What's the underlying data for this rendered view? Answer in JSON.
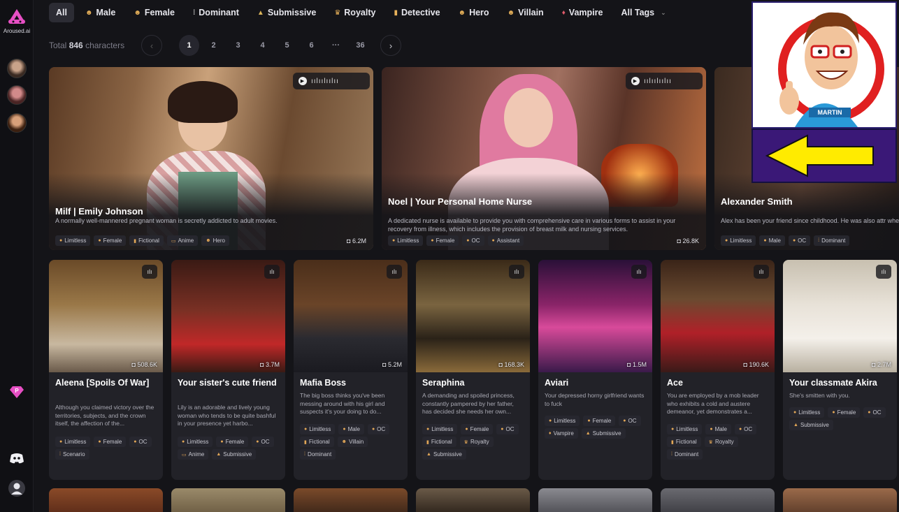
{
  "app": {
    "logo_text": "Aroused.ai"
  },
  "tags": [
    {
      "label": "All",
      "icon": "",
      "active": true
    },
    {
      "label": "Male",
      "icon": "☻"
    },
    {
      "label": "Female",
      "icon": "☻"
    },
    {
      "label": "Dominant",
      "icon": "⁞"
    },
    {
      "label": "Submissive",
      "icon": "▲"
    },
    {
      "label": "Royalty",
      "icon": "♛"
    },
    {
      "label": "Detective",
      "icon": "▮"
    },
    {
      "label": "Hero",
      "icon": "☻"
    },
    {
      "label": "Villain",
      "icon": "☻"
    },
    {
      "label": "Vampire",
      "icon": "♦"
    },
    {
      "label": "All Tags",
      "icon": ""
    }
  ],
  "pagination": {
    "total_prefix": "Total",
    "total_count": "846",
    "total_suffix": "characters",
    "pages": [
      "1",
      "2",
      "3",
      "4",
      "5",
      "6",
      "···",
      "36"
    ],
    "active_page": "1"
  },
  "featured": [
    {
      "name": "Milf | Emily Johnson",
      "desc": "A normally well-mannered pregnant woman is secretly addicted to adult movies.",
      "tags": [
        "Limitless",
        "Female",
        "Fictional",
        "Anime",
        "Hero"
      ],
      "count": "6.2M"
    },
    {
      "name": "Noel | Your Personal Home Nurse",
      "desc": "A dedicated nurse is available to provide you with comprehensive care in various forms to assist in your recovery from illness, which includes the provision of breast milk and nursing services.",
      "tags": [
        "Limitless",
        "Female",
        "OC",
        "Assistant"
      ],
      "count": "26.8K"
    },
    {
      "name": "Alexander Smith",
      "desc": "Alex has been your friend since childhood. He was also attr when he asked you to go to the drive-in theater, and you su",
      "tags": [
        "Limitless",
        "Male",
        "OC",
        "Dominant"
      ],
      "count": ""
    }
  ],
  "cards": [
    {
      "title": "Aleena [Spoils Of War]",
      "desc": "Although you claimed victory over the territories, subjects, and the crown itself, the affection of the...",
      "tags": [
        "Limitless",
        "Female",
        "OC",
        "Scenario"
      ],
      "count": "508.6K"
    },
    {
      "title": "Your sister's cute friend",
      "desc": "Lily is an adorable and lively young woman who tends to be quite bashful in your presence yet harbo...",
      "tags": [
        "Limitless",
        "Female",
        "OC",
        "Anime",
        "Submissive"
      ],
      "count": "3.7M"
    },
    {
      "title": "Mafia Boss",
      "desc": "The big boss thinks you've been messing around with his girl and suspects it's your doing to do...",
      "tags": [
        "Limitless",
        "Male",
        "OC",
        "Fictional",
        "Villain",
        "Dominant"
      ],
      "count": "5.2M"
    },
    {
      "title": "Seraphina",
      "desc": "A demanding and spoiled princess, constantly pampered by her father, has decided she needs her own...",
      "tags": [
        "Limitless",
        "Female",
        "OC",
        "Fictional",
        "Royalty",
        "Submissive"
      ],
      "count": "168.3K"
    },
    {
      "title": "Aviari",
      "desc": "Your depressed horny girlfriend wants to fuck",
      "tags": [
        "Limitless",
        "Female",
        "OC",
        "Vampire",
        "Submissive"
      ],
      "count": "1.5M"
    },
    {
      "title": "Ace",
      "desc": "You are employed by a mob leader who exhibits a cold and austere demeanor, yet demonstrates a...",
      "tags": [
        "Limitless",
        "Male",
        "OC",
        "Fictional",
        "Royalty",
        "Dominant"
      ],
      "count": "190.6K"
    },
    {
      "title": "Your classmate Akira",
      "desc": "She's smitten with you.",
      "tags": [
        "Limitless",
        "Female",
        "OC",
        "Submissive"
      ],
      "count": "2.7M"
    }
  ],
  "overlay": {
    "badge_text": "MARTIN"
  },
  "colors": {
    "bg": "#141418",
    "accent": "#e64fc4",
    "chip_icon": "#e2a757",
    "overlay_purple": "#3a1877",
    "arrow_yellow": "#ffeb00"
  }
}
